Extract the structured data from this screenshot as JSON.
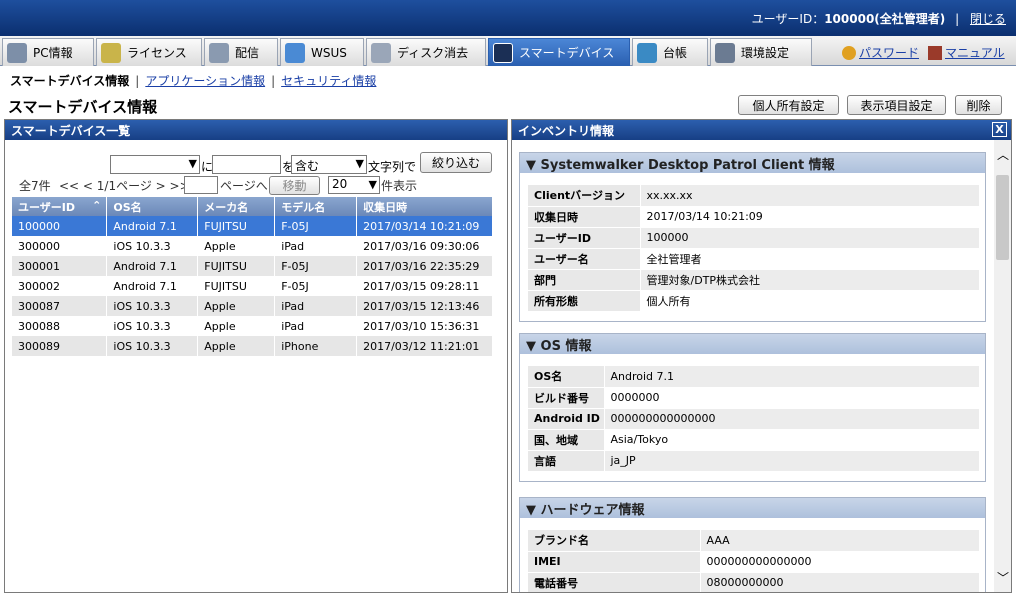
{
  "header": {
    "user_prefix": "ユーザーID：",
    "user_id": "100000(全社管理者)",
    "separator": "|",
    "close_label": "閉じる"
  },
  "tabs": [
    {
      "label": "PC情報",
      "icon": "pc-icon"
    },
    {
      "label": "ライセンス",
      "icon": "license-icon"
    },
    {
      "label": "配信",
      "icon": "delivery-icon"
    },
    {
      "label": "WSUS",
      "icon": "wsus-icon"
    },
    {
      "label": "ディスク消去",
      "icon": "disk-erase-icon"
    },
    {
      "label": "スマートデバイス",
      "icon": "smart-device-icon"
    },
    {
      "label": "台帳",
      "icon": "ledger-icon"
    },
    {
      "label": "環境設定",
      "icon": "settings-icon"
    }
  ],
  "right_links": {
    "password": "パスワード",
    "manual": "マニュアル"
  },
  "subnav": {
    "current": "スマートデバイス情報",
    "app_info": "アプリケーション情報",
    "security_info": "セキュリティ情報",
    "sep": "|"
  },
  "page": {
    "title": "スマートデバイス情報",
    "btn_personal": "個人所有設定",
    "btn_display": "表示項目設定",
    "btn_delete": "削除"
  },
  "left_panel": {
    "title": "スマートデバイス一覧",
    "filter": {
      "field_value": "",
      "ni_label": "に",
      "text_value": "",
      "wo_label": "を",
      "match_value": "含む",
      "suffix": "文字列で",
      "button": "絞り込む"
    },
    "pager": {
      "total": "全7件",
      "nav_prev": "<< < 1/1ページ > >>",
      "page_input": "",
      "goto_label": "ページへ",
      "move_button": "移動",
      "per_page": "20",
      "per_page_suffix": "件表示"
    },
    "columns": [
      "ユーザーID",
      "OS名",
      "メーカ名",
      "モデル名",
      "収集日時"
    ],
    "rows": [
      [
        "100000",
        "Android 7.1",
        "FUJITSU",
        "F-05J",
        "2017/03/14 10:21:09"
      ],
      [
        "300000",
        "iOS 10.3.3",
        "Apple",
        "iPad",
        "2017/03/16 09:30:06"
      ],
      [
        "300001",
        "Android 7.1",
        "FUJITSU",
        "F-05J",
        "2017/03/16 22:35:29"
      ],
      [
        "300002",
        "Android 7.1",
        "FUJITSU",
        "F-05J",
        "2017/03/15 09:28:11"
      ],
      [
        "300087",
        "iOS 10.3.3",
        "Apple",
        "iPad",
        "2017/03/15 12:13:46"
      ],
      [
        "300088",
        "iOS 10.3.3",
        "Apple",
        "iPad",
        "2017/03/10 15:36:31"
      ],
      [
        "300089",
        "iOS 10.3.3",
        "Apple",
        "iPhone",
        "2017/03/12 11:21:01"
      ]
    ]
  },
  "right_panel": {
    "title": "インベントリ情報",
    "close": "X",
    "sections": [
      {
        "title": "▼ Systemwalker Desktop Patrol Client 情報",
        "rows": [
          [
            "Clientバージョン",
            "xx.xx.xx"
          ],
          [
            "収集日時",
            "2017/03/14 10:21:09"
          ],
          [
            "ユーザーID",
            "100000"
          ],
          [
            "ユーザー名",
            "全社管理者"
          ],
          [
            "部門",
            "管理対象/DTP株式会社"
          ],
          [
            "所有形態",
            "個人所有"
          ]
        ]
      },
      {
        "title": "▼ OS 情報",
        "rows": [
          [
            "OS名",
            "Android 7.1"
          ],
          [
            "ビルド番号",
            "0000000"
          ],
          [
            "Android ID",
            "000000000000000"
          ],
          [
            "国、地域",
            "Asia/Tokyo"
          ],
          [
            "言語",
            "ja_JP"
          ]
        ]
      },
      {
        "title": "▼ ハードウェア情報",
        "rows": [
          [
            "ブランド名",
            "AAA"
          ],
          [
            "IMEI",
            "000000000000000"
          ],
          [
            "電話番号",
            "08000000000"
          ]
        ]
      }
    ]
  },
  "colors": {
    "header_blue": "#1e4f9e",
    "tab_active": "#2a5fb0",
    "selected_row": "#3a78d6",
    "link": "#1a3fa6"
  }
}
